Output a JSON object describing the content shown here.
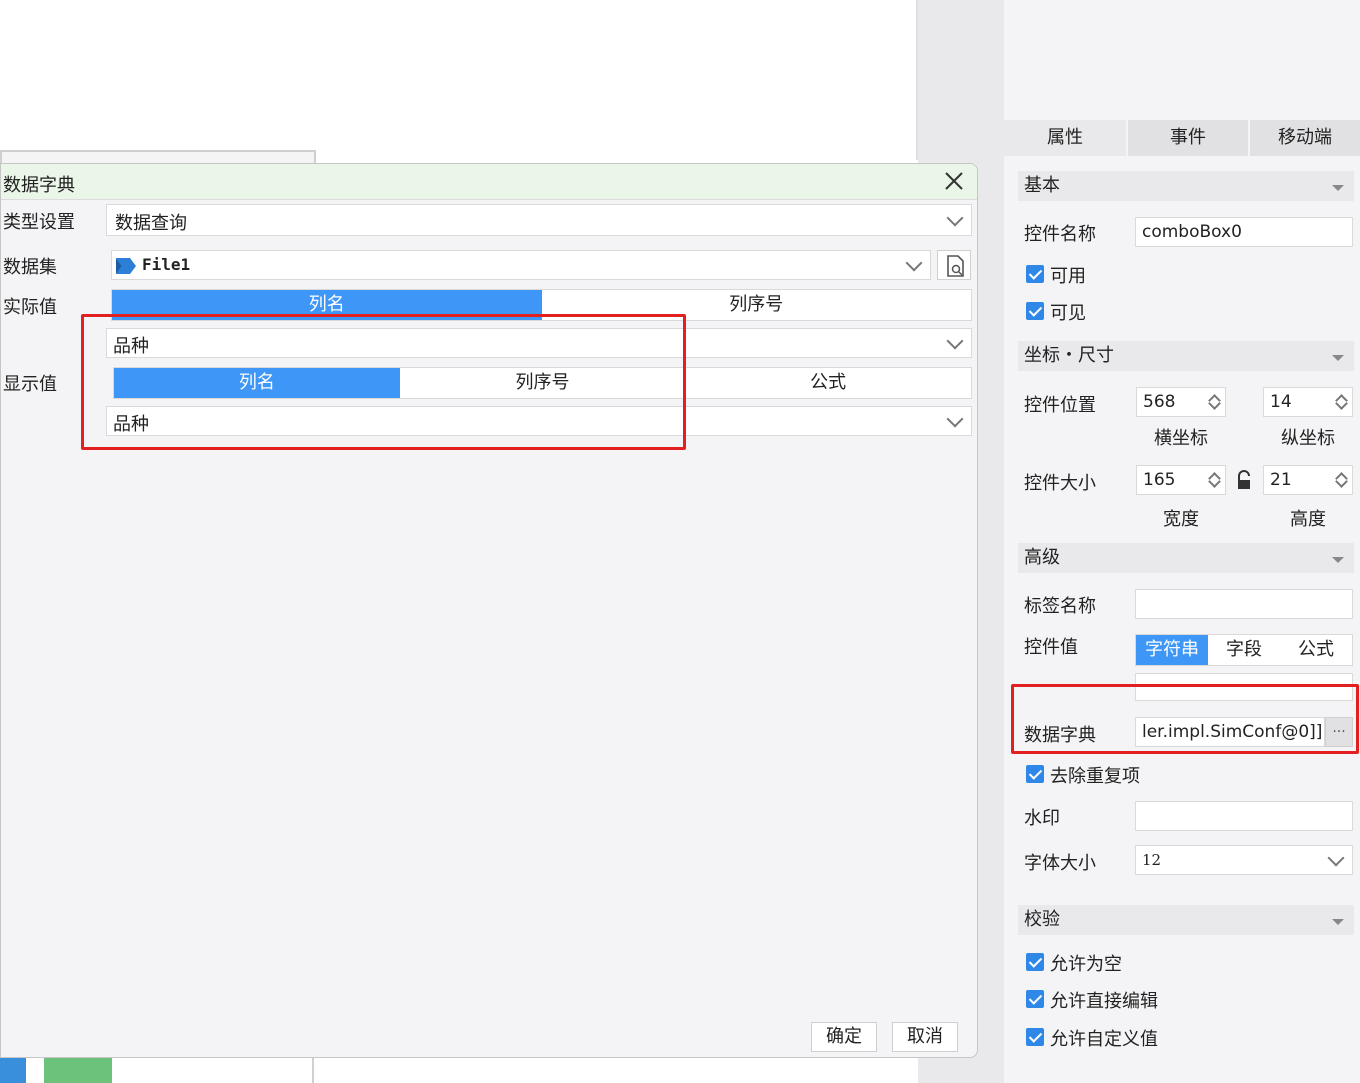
{
  "dialog": {
    "title": "数据字典",
    "type_label": "类型设置",
    "type_value": "数据查询",
    "dataset_label": "数据集",
    "dataset_value": "File1",
    "actual_label": "实际值",
    "actual_tabs": [
      "列名",
      "列序号"
    ],
    "actual_value": "品种",
    "display_label": "显示值",
    "display_tabs": [
      "列名",
      "列序号",
      "公式"
    ],
    "display_value": "品种",
    "ok_label": "确定",
    "cancel_label": "取消"
  },
  "panel": {
    "tabs": [
      "属性",
      "事件",
      "移动端"
    ],
    "basic": {
      "title": "基本",
      "name_label": "控件名称",
      "name_value": "comboBox0",
      "enabled_label": "可用",
      "visible_label": "可见"
    },
    "geometry": {
      "title": "坐标・尺寸",
      "pos_label": "控件位置",
      "x_value": "568",
      "y_value": "14",
      "x_caption": "横坐标",
      "y_caption": "纵坐标",
      "size_label": "控件大小",
      "w_value": "165",
      "h_value": "21",
      "w_caption": "宽度",
      "h_caption": "高度"
    },
    "advanced": {
      "title": "高级",
      "tag_label": "标签名称",
      "value_label": "控件值",
      "value_tabs": [
        "字符串",
        "字段",
        "公式"
      ],
      "dict_label": "数据字典",
      "dict_value": "ler.impl.SimConf@0]]",
      "dict_button": "···",
      "dedupe_label": "去除重复项",
      "watermark_label": "水印",
      "fontsize_label": "字体大小",
      "fontsize_value": "12"
    },
    "validation": {
      "title": "校验",
      "allow_empty": "允许为空",
      "allow_edit": "允许直接编辑",
      "allow_custom": "允许自定义值"
    }
  },
  "colors": {
    "accent": "#3e97f7",
    "highlight": "#e32020",
    "title_bar": "#eaf6e8",
    "checkbox": "#2f88e8"
  }
}
